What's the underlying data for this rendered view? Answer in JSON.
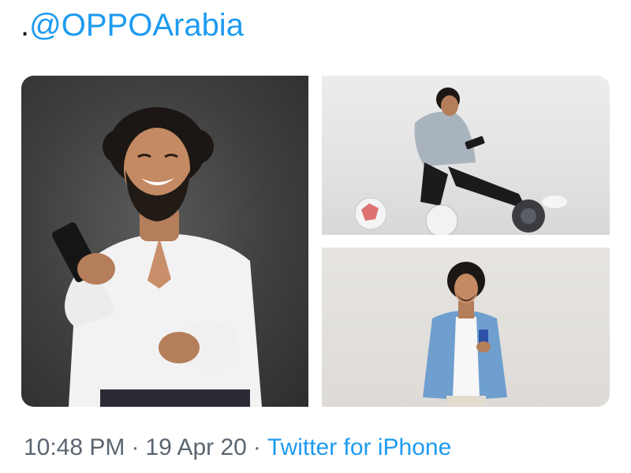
{
  "tweet": {
    "mention_prefix": ".",
    "mention": "@OPPOArabia",
    "time": "10:48 PM",
    "date": "19 Apr 20",
    "separator": "·",
    "source": "Twitter for iPhone"
  },
  "media": {
    "images": [
      {
        "name": "photo-portrait-smiling-with-phone"
      },
      {
        "name": "photo-sitting-with-footballs"
      },
      {
        "name": "photo-standing-denim-jacket"
      }
    ]
  },
  "colors": {
    "link": "#1d9bf0",
    "meta_text": "#5b6570",
    "text": "#14171a"
  }
}
